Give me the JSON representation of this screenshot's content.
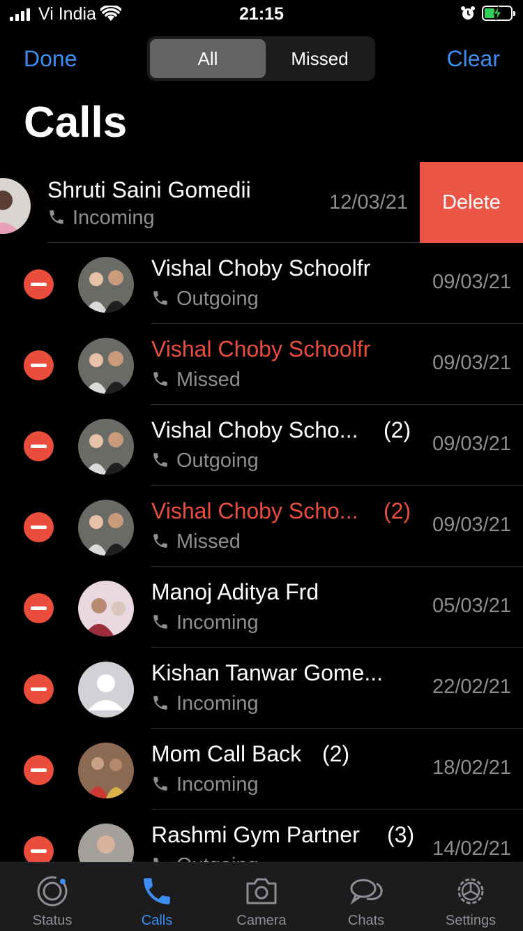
{
  "status_bar": {
    "carrier": "Vi India",
    "time": "21:15"
  },
  "nav": {
    "done": "Done",
    "clear": "Clear",
    "segments": [
      "All",
      "Missed"
    ],
    "title": "Calls"
  },
  "swiped_row": {
    "name": "Shruti Saini Gomedii",
    "type": "Incoming",
    "date": "12/03/21",
    "delete_label": "Delete"
  },
  "calls": [
    {
      "name": "Vishal Choby Schoolfr",
      "count": "",
      "type": "Outgoing",
      "date": "09/03/21",
      "missed": false
    },
    {
      "name": "Vishal Choby Schoolfr",
      "count": "",
      "type": "Missed",
      "date": "09/03/21",
      "missed": true
    },
    {
      "name": "Vishal Choby Scho...",
      "count": "(2)",
      "type": "Outgoing",
      "date": "09/03/21",
      "missed": false
    },
    {
      "name": "Vishal Choby Scho...",
      "count": "(2)",
      "type": "Missed",
      "date": "09/03/21",
      "missed": true
    },
    {
      "name": "Manoj Aditya Frd",
      "count": "",
      "type": "Incoming",
      "date": "05/03/21",
      "missed": false
    },
    {
      "name": "Kishan Tanwar Gome...",
      "count": "",
      "type": "Incoming",
      "date": "22/02/21",
      "missed": false
    },
    {
      "name": "Mom Call Back",
      "count": "(2)",
      "type": "Incoming",
      "date": "18/02/21",
      "missed": false
    },
    {
      "name": "Rashmi Gym Partner",
      "count": "(3)",
      "type": "Outgoing",
      "date": "14/02/21",
      "missed": false
    }
  ],
  "tabs": [
    {
      "label": "Status",
      "icon": "status-icon"
    },
    {
      "label": "Calls",
      "icon": "phone-icon"
    },
    {
      "label": "Camera",
      "icon": "camera-icon"
    },
    {
      "label": "Chats",
      "icon": "chat-bubbles-icon"
    },
    {
      "label": "Settings",
      "icon": "gear-icon"
    }
  ],
  "colors": {
    "accent": "#3d8ef0",
    "danger": "#eb4d3d",
    "secondary_text": "#8e8e93",
    "background": "#000000"
  }
}
